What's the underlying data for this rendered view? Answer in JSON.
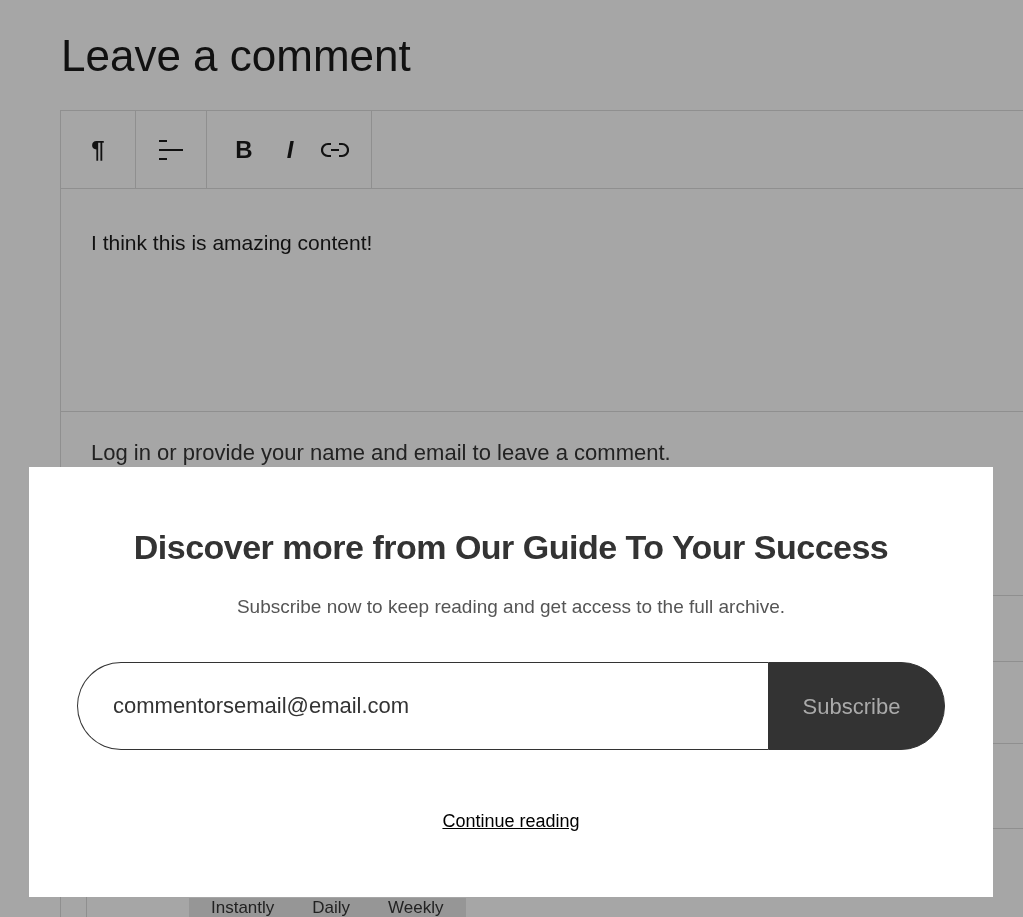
{
  "heading": "Leave a comment",
  "toolbar": [
    {
      "kind": "glyph",
      "label": "¶"
    },
    {
      "kind": "align-icon"
    },
    {
      "kind": "glyph",
      "label": "B"
    },
    {
      "kind": "glyph",
      "label": "I"
    },
    {
      "kind": "link-icon"
    }
  ],
  "comment_text": "I think this is amazing content!",
  "login_prompt": "Log in or provide your name and email to leave a comment.",
  "frequency_tabs": [
    "Instantly",
    "Daily",
    "Weekly"
  ],
  "modal": {
    "title": "Discover more from Our Guide To Your Success",
    "subtitle": "Subscribe now to keep reading and get access to the full archive.",
    "email_value": "commentorsemail@email.com",
    "subscribe_button": "Subscribe",
    "continue_link": "Continue reading"
  }
}
